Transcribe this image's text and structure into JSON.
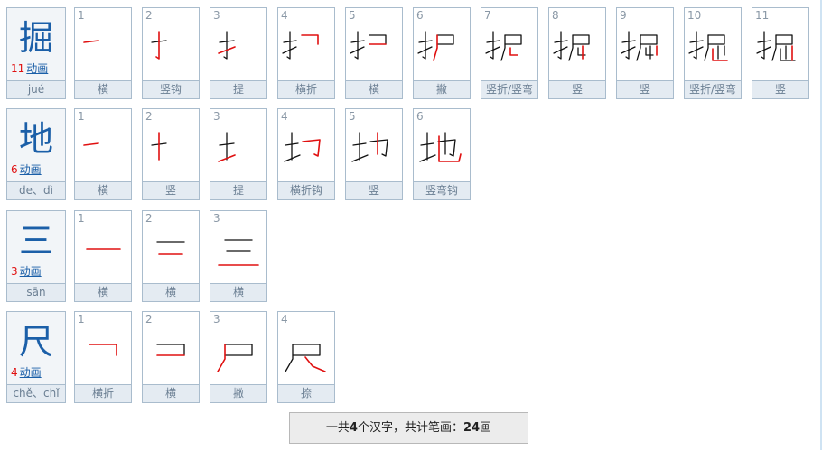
{
  "characters": [
    {
      "char": "掘",
      "stroke_count": "11",
      "anim_label": "动画",
      "pinyin": "jué",
      "steps": [
        {
          "n": "1",
          "name": "横",
          "partial": "一"
        },
        {
          "n": "2",
          "name": "竖钩",
          "partial": "亅"
        },
        {
          "n": "3",
          "name": "提",
          "partial": "扌"
        },
        {
          "n": "4",
          "name": "横折",
          "partial": "扌"
        },
        {
          "n": "5",
          "name": "横",
          "partial": "扌"
        },
        {
          "n": "6",
          "name": "撇",
          "partial": "护"
        },
        {
          "n": "7",
          "name": "竖折/竖弯",
          "partial": "护"
        },
        {
          "n": "8",
          "name": "竖",
          "partial": "护"
        },
        {
          "n": "9",
          "name": "竖",
          "partial": "掘"
        },
        {
          "n": "10",
          "name": "竖折/竖弯",
          "partial": "掘"
        },
        {
          "n": "11",
          "name": "竖",
          "partial": "掘"
        }
      ]
    },
    {
      "char": "地",
      "stroke_count": "6",
      "anim_label": "动画",
      "pinyin": "de、dì",
      "steps": [
        {
          "n": "1",
          "name": "横",
          "partial": "一"
        },
        {
          "n": "2",
          "name": "竖",
          "partial": "十"
        },
        {
          "n": "3",
          "name": "提",
          "partial": "土"
        },
        {
          "n": "4",
          "name": "横折钩",
          "partial": "地"
        },
        {
          "n": "5",
          "name": "竖",
          "partial": "地"
        },
        {
          "n": "6",
          "name": "竖弯钩",
          "partial": "地"
        }
      ]
    },
    {
      "char": "三",
      "stroke_count": "3",
      "anim_label": "动画",
      "pinyin": "sān",
      "steps": [
        {
          "n": "1",
          "name": "横",
          "partial": "一"
        },
        {
          "n": "2",
          "name": "横",
          "partial": "二"
        },
        {
          "n": "3",
          "name": "横",
          "partial": "三"
        }
      ]
    },
    {
      "char": "尺",
      "stroke_count": "4",
      "anim_label": "动画",
      "pinyin": "chě、chǐ",
      "steps": [
        {
          "n": "1",
          "name": "横折",
          "partial": "ㄱ"
        },
        {
          "n": "2",
          "name": "横",
          "partial": "コ"
        },
        {
          "n": "3",
          "name": "撇",
          "partial": "尸"
        },
        {
          "n": "4",
          "name": "捺",
          "partial": "尺"
        }
      ]
    }
  ],
  "summary": {
    "prefix": "一共",
    "char_count": "4",
    "middle": "个汉字，共计笔画：",
    "total_strokes": "24",
    "suffix": "画"
  },
  "colors": {
    "current_stroke": "#e01010",
    "done_stroke": "#111111",
    "char": "#1b5fa8"
  }
}
